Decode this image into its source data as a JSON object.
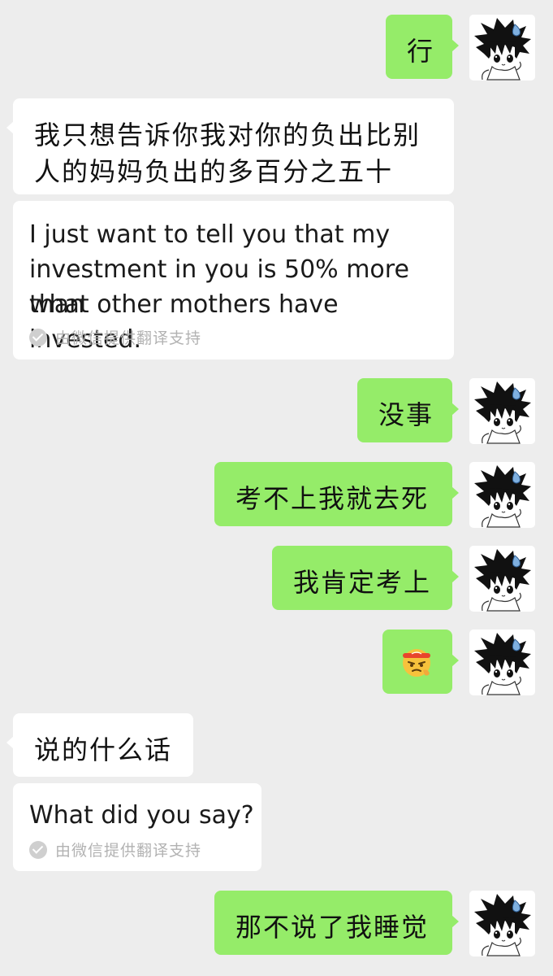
{
  "messages": [
    {
      "id": "m1",
      "side": "sent",
      "text": "行"
    },
    {
      "id": "m2",
      "side": "received",
      "text": "我只想告诉你我对你的负出比别",
      "text_line2": "人的妈妈负出的多百分之五十"
    },
    {
      "id": "m3",
      "side": "translation",
      "lines": [
        "I just want to tell you that my",
        "investment in you is 50% more than",
        "what other mothers have invested."
      ]
    },
    {
      "id": "m4",
      "side": "sent",
      "text": "没事"
    },
    {
      "id": "m5",
      "side": "sent",
      "text": "考不上我就去死"
    },
    {
      "id": "m6",
      "side": "sent",
      "text": "我肯定考上"
    },
    {
      "id": "m7",
      "side": "sent",
      "emoji": "determined-face-with-headband"
    },
    {
      "id": "m8",
      "side": "received",
      "text": "说的什么话"
    },
    {
      "id": "m9",
      "side": "translation",
      "lines": [
        "What did you say?"
      ]
    },
    {
      "id": "m10",
      "side": "sent",
      "text": "那不说了我睡觉"
    }
  ],
  "translation_provider": "由微信提供翻译支持",
  "colors": {
    "background": "#ededed",
    "sent_bubble": "#95ec69",
    "received_bubble": "#ffffff",
    "provider_text": "#b2b2b2"
  },
  "icons": {
    "avatar": "anime-character-avatar",
    "provider_check": "check-circle-icon",
    "emoji": "face-with-headband-emoji"
  }
}
